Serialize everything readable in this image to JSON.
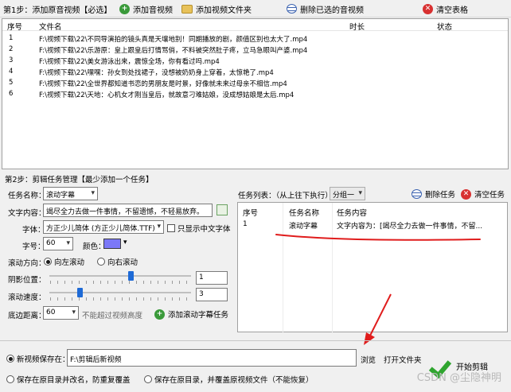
{
  "toolbar": {
    "step1_label": "第1步：添加原音视频【必选】",
    "add_video": "添加音视频",
    "add_folder": "添加视频文件夹",
    "delete_selected": "删除已选的音视频",
    "clear_table": "清空表格"
  },
  "file_table": {
    "headers": {
      "index": "序号",
      "filename": "文件名",
      "duration": "时长",
      "status": "状态"
    },
    "rows": [
      {
        "index": "1",
        "filename": "F:\\视频下载\\22\\不同导演拍的镜头真是天壤地别！同期播放的剧，颜值区别也太大了.mp4"
      },
      {
        "index": "2",
        "filename": "F:\\视频下载\\22\\乐游原：皇上跟皇后打情骂俏，不料被突然肚子疼，立马急眼叫产婆.mp4"
      },
      {
        "index": "3",
        "filename": "F:\\视频下载\\22\\美女游泳出来，震惊全场，你有看过吗.mp4"
      },
      {
        "index": "4",
        "filename": "F:\\视频下载\\22\\嘿嘿：孙女到处找裙子，没想被奶奶身上穿着，太惊艳了.mp4"
      },
      {
        "index": "5",
        "filename": "F:\\视频下载\\22\\全世界都知道书恋的男朋友是时景，好像就未来过母亲不相信.mp4"
      },
      {
        "index": "6",
        "filename": "F:\\视频下载\\22\\天地：心机女才刚当皇后，就故意刁难姑娘，没成想姑娘是太后.mp4"
      }
    ]
  },
  "step2": {
    "label": "第2步：剪辑任务管理【最少添加一个任务】",
    "task_name_label": "任务名称：",
    "task_name_value": "滚动字幕",
    "text_content_label": "文字内容：",
    "text_content_value": "竭尽全力去做一件事情，不留遗憾，不轻易放弃。",
    "font_label": "字体：",
    "font_value": "方正少儿简体 (方正少儿简体.TTF)",
    "only_chinese_label": "只显示中文字体",
    "size_label": "字号：",
    "size_value": "60",
    "color_label": "颜色：",
    "direction_label": "滚动方向：",
    "direction_left": "向左滚动",
    "direction_right": "向右滚动",
    "shadow_label": "阴影位置：",
    "shadow_value": "1",
    "speed_label": "滚动速度：",
    "speed_value": "3",
    "bottom_label": "底边距离：",
    "bottom_value": "60",
    "bottom_hint": "不能超过视频高度",
    "add_task_button": "添加滚动字幕任务",
    "color_swatch": "#7b78f7"
  },
  "task_list": {
    "label": "任务列表：（从上往下执行）",
    "group_value": "分组一",
    "delete_task": "删除任务",
    "clear_tasks": "清空任务",
    "headers": {
      "index": "序号",
      "name": "任务名称",
      "content": "任务内容"
    },
    "rows": [
      {
        "index": "1",
        "name": "滚动字幕",
        "content": "文字内容为：[竭尽全力去做一件事情，不留..."
      }
    ]
  },
  "output": {
    "new_save_label": "新视频保存在：",
    "path_value": "F:\\剪辑后新视频",
    "browse": "浏览",
    "open_folder": "打开文件夹",
    "save_rename_label": "保存在原目录并改名，防重复覆盖",
    "save_overwrite_label": "保存在原目录，并覆盖原视频文件（不能恢复）",
    "start_button": "开始剪辑"
  },
  "watermark": "CSDN @尘隐神明"
}
